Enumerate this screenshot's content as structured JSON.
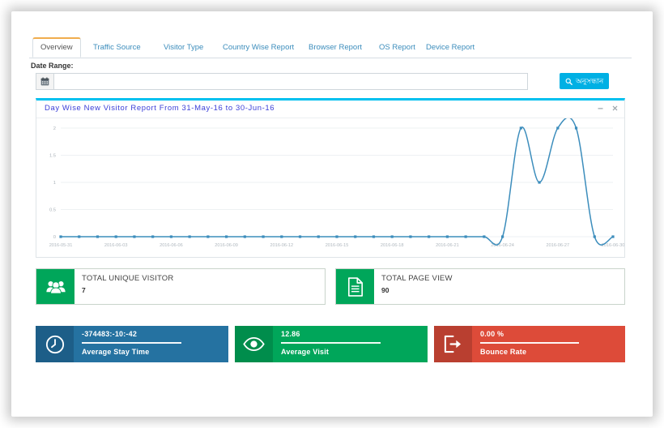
{
  "window": {
    "topbar_color": "#3c8dbc"
  },
  "tabs": [
    {
      "label": "Overview",
      "active": true
    },
    {
      "label": "Traffic Source",
      "active": false
    },
    {
      "label": "Visitor Type",
      "active": false
    },
    {
      "label": "Country Wise Report",
      "active": false
    },
    {
      "label": "Browser Report",
      "active": false
    },
    {
      "label": "OS Report",
      "active": false
    },
    {
      "label": "Device Report",
      "active": false
    }
  ],
  "filters": {
    "date_range_label": "Date Range:",
    "date_range_value": "",
    "date_range_placeholder": "",
    "calendar_icon": "calendar-icon",
    "search_button_label": "অনুসন্ধান",
    "search_button_icon": "search-icon",
    "search_button_color": "#00b0e4"
  },
  "chart_panel": {
    "title": "Day Wise New Visitor Report From 31-May-16 to 30-Jun-16",
    "title_color": "#3b3fd8",
    "accent_color": "#00c0ef",
    "minimize_icon": "minimize-icon",
    "close_icon": "close-icon"
  },
  "chart_data": {
    "type": "line",
    "title": "Day Wise New Visitor Report From 31-May-16 to 30-Jun-16",
    "xlabel": "",
    "ylabel": "",
    "ylim": [
      0,
      2
    ],
    "yticks": [
      0,
      0.5,
      1,
      1.5,
      2
    ],
    "ytick_labels": [
      "0",
      "0.5",
      "1",
      "1.5",
      "2"
    ],
    "grid": true,
    "legend": false,
    "line_color": "#3c8dbc",
    "marker": "square",
    "x": [
      "2016-05-31",
      "2016-06-01",
      "2016-06-02",
      "2016-06-03",
      "2016-06-04",
      "2016-06-05",
      "2016-06-06",
      "2016-06-07",
      "2016-06-08",
      "2016-06-09",
      "2016-06-10",
      "2016-06-11",
      "2016-06-12",
      "2016-06-13",
      "2016-06-14",
      "2016-06-15",
      "2016-06-16",
      "2016-06-17",
      "2016-06-18",
      "2016-06-19",
      "2016-06-20",
      "2016-06-21",
      "2016-06-22",
      "2016-06-23",
      "2016-06-24",
      "2016-06-25",
      "2016-06-26",
      "2016-06-27",
      "2016-06-28",
      "2016-06-29",
      "2016-06-30"
    ],
    "xtick_labels": [
      "2016-05-31",
      "2016-06-03",
      "2016-06-06",
      "2016-06-09",
      "2016-06-12",
      "2016-06-15",
      "2016-06-18",
      "2016-06-21",
      "2016-06-24",
      "2016-06-27",
      "2016-06-30"
    ],
    "series": [
      {
        "name": "New Visitor",
        "values": [
          0,
          0,
          0,
          0,
          0,
          0,
          0,
          0,
          0,
          0,
          0,
          0,
          0,
          0,
          0,
          0,
          0,
          0,
          0,
          0,
          0,
          0,
          0,
          0,
          0,
          2,
          1,
          2,
          2,
          0,
          0
        ]
      }
    ]
  },
  "stat_boxes": [
    {
      "title": "TOTAL UNIQUE VISITOR",
      "value": "7",
      "icon": "users-icon",
      "color": "#00a65a"
    },
    {
      "title": "TOTAL PAGE VIEW",
      "value": "90",
      "icon": "document-icon",
      "color": "#00a65a"
    }
  ],
  "kpi_boxes": [
    {
      "value": "-374483:-10:-42",
      "label": "Average Stay Time",
      "icon": "clock-icon",
      "color": "#2572a1"
    },
    {
      "value": "12.86",
      "label": "Average Visit",
      "icon": "eye-icon",
      "color": "#00a65a"
    },
    {
      "value": "0.00 %",
      "label": "Bounce Rate",
      "icon": "sign-out-icon",
      "color": "#dd4b39"
    }
  ]
}
